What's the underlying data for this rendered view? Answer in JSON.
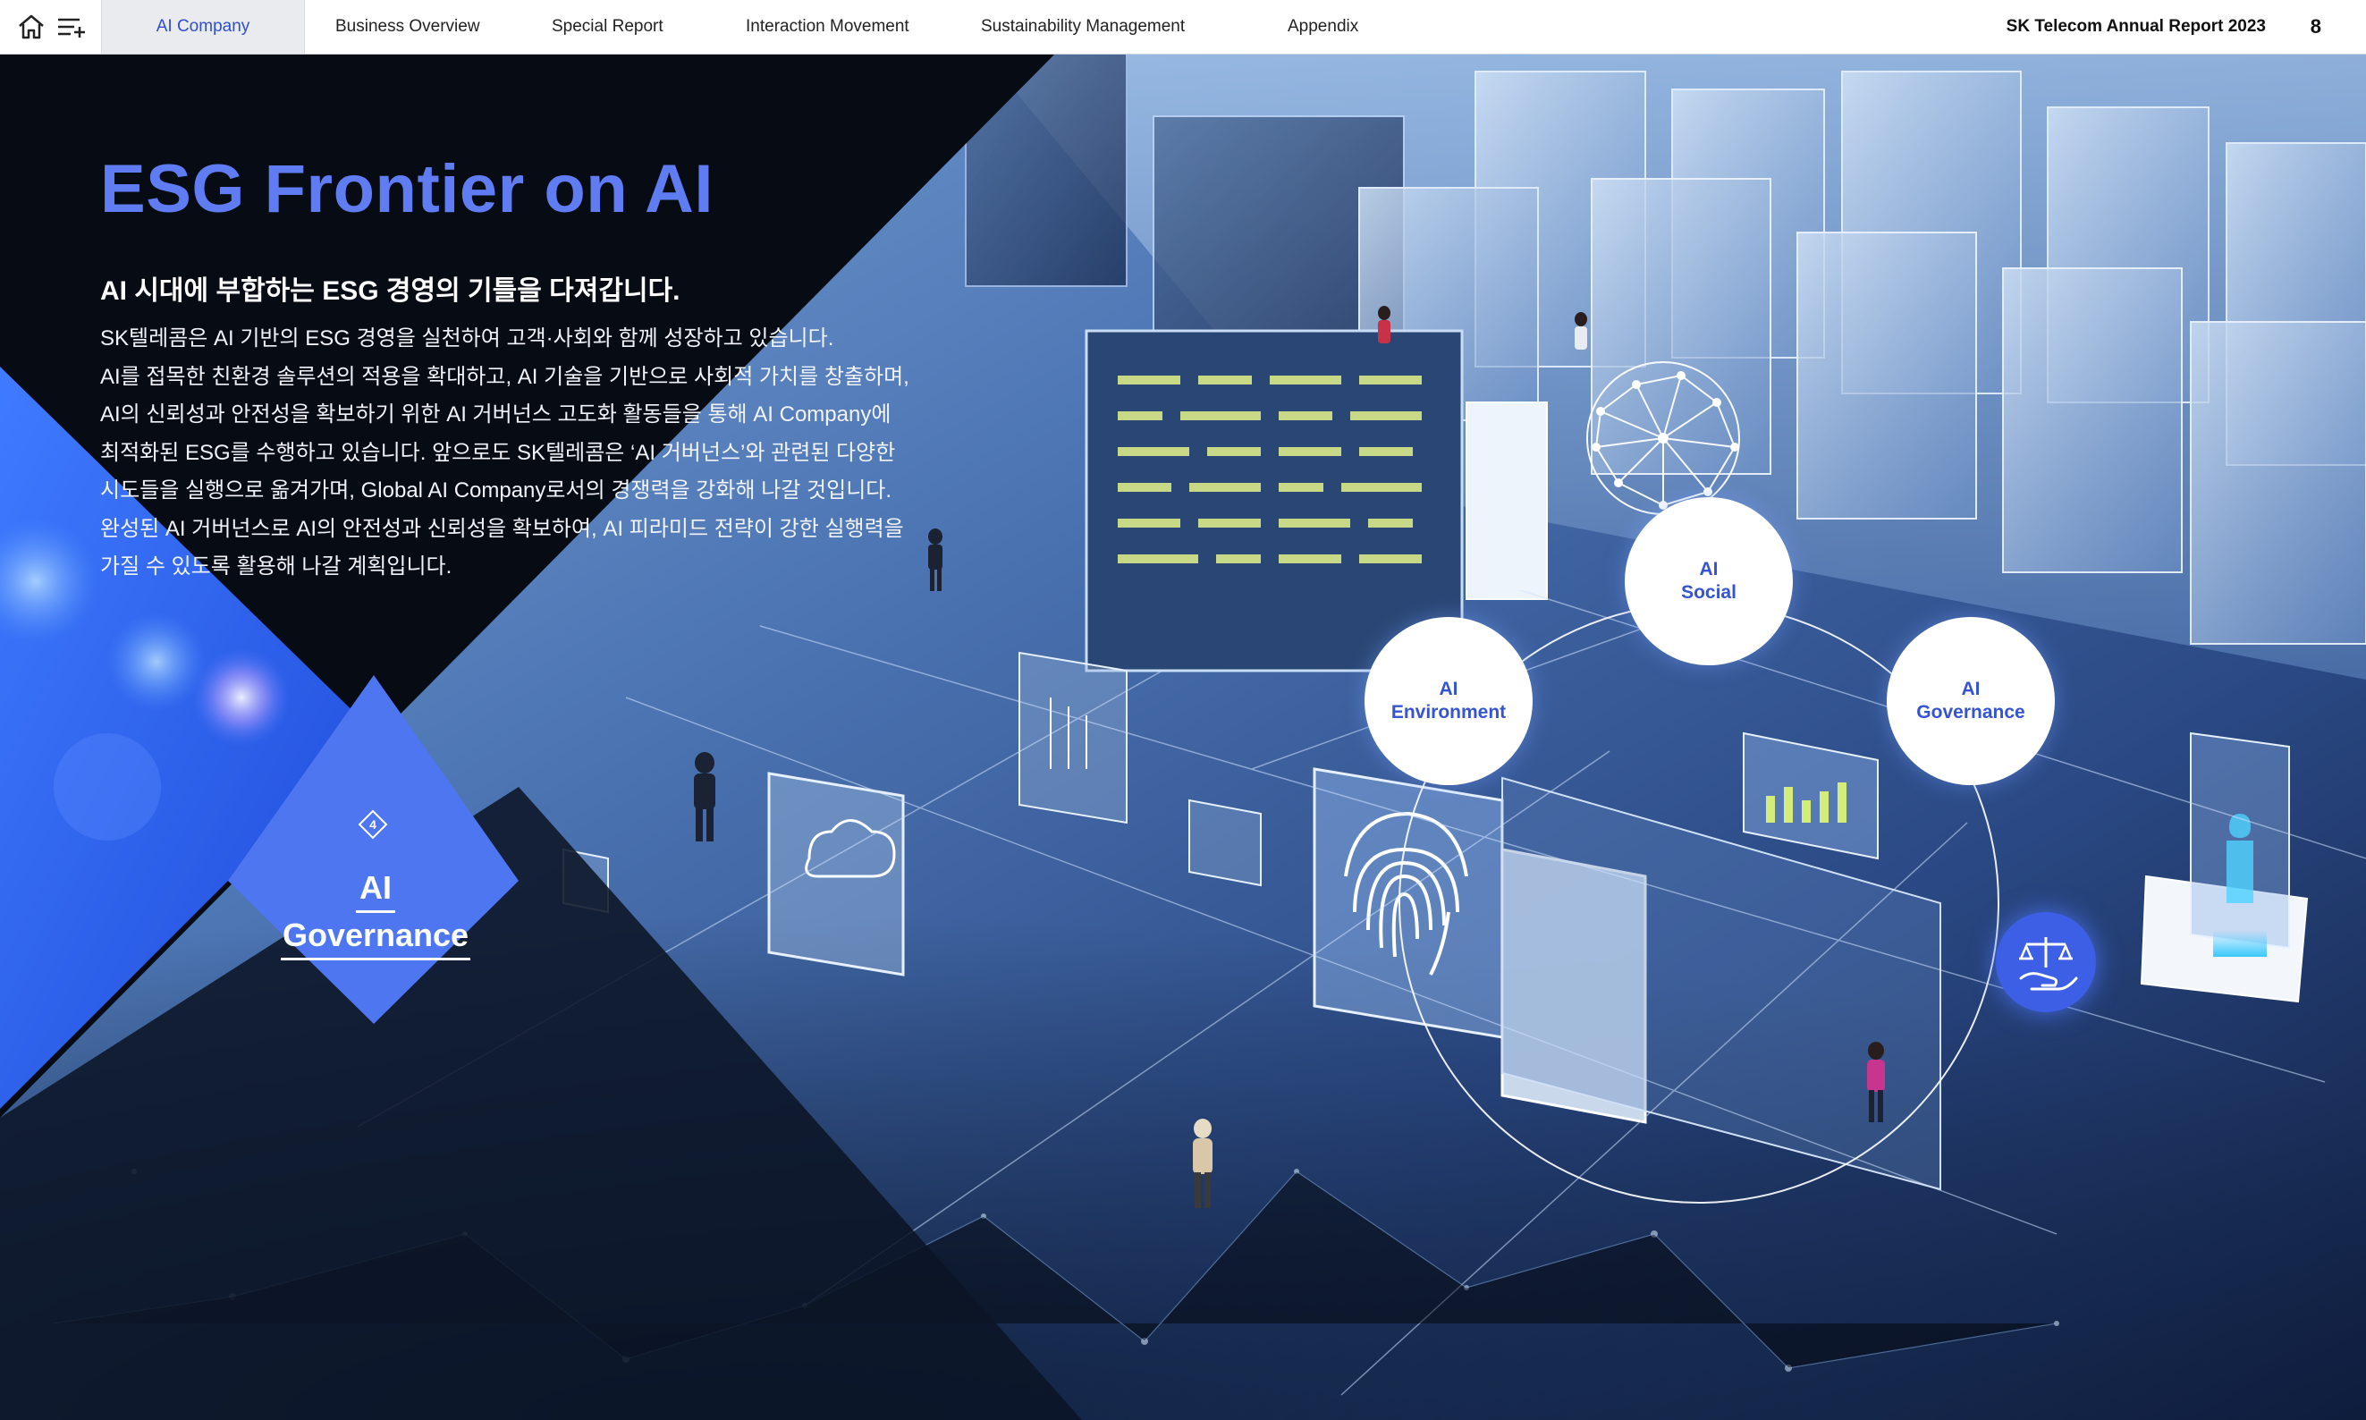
{
  "nav": {
    "tabs": [
      {
        "label": "AI Company",
        "active": true
      },
      {
        "label": "Business Overview"
      },
      {
        "label": "Special Report"
      },
      {
        "label": "Interaction Movement"
      },
      {
        "label": "Sustainability Management"
      },
      {
        "label": "Appendix"
      }
    ],
    "report_title": "SK Telecom Annual Report 2023",
    "page_number": "8",
    "icons": [
      "home-icon",
      "menu-list-icon"
    ]
  },
  "hero": {
    "title": "ESG Frontier on AI",
    "subtitle": "AI 시대에 부합하는 ESG 경영의 기틀을 다져갑니다.",
    "body_lines": [
      "SK텔레콤은 AI 기반의 ESG 경영을 실천하여 고객·사회와 함께 성장하고 있습니다.",
      "AI를 접목한 친환경 솔루션의 적용을 확대하고, AI 기술을 기반으로 사회적 가치를 창출하며,",
      "AI의 신뢰성과 안전성을 확보하기 위한 AI 거버넌스 고도화 활동들을 통해 AI Company에",
      "최적화된 ESG를 수행하고 있습니다. 앞으로도 SK텔레콤은 ‘AI 거버넌스’와 관련된 다양한",
      "시도들을 실행으로 옮겨가며, Global AI Company로서의 경쟁력을 강화해 나갈 것입니다.",
      "완성된 AI 거버넌스로 AI의 안전성과 신뢰성을 확보하여, AI 피라미드 전략이 강한 실행력을",
      "가질 수 있도록 활용해 나갈 계획입니다."
    ]
  },
  "pillars": {
    "environment": {
      "line1": "AI",
      "line2": "Environment"
    },
    "social": {
      "line1": "AI",
      "line2": "Social"
    },
    "governance": {
      "line1": "AI",
      "line2": "Governance"
    }
  },
  "badge": {
    "number": "4",
    "line1": "AI",
    "line2": "Governance"
  },
  "colors": {
    "accent_blue": "#5f7cf2",
    "pillar_text": "#3554d4",
    "badge_blue": "#4d76f0",
    "nav_active_bg": "#e9ebee"
  }
}
